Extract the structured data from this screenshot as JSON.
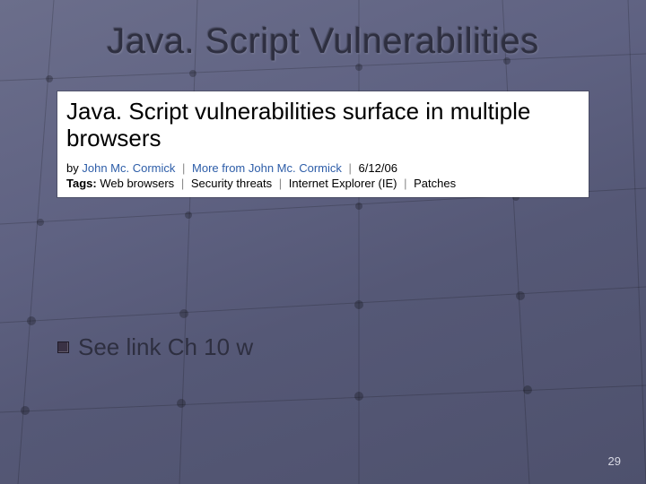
{
  "title": "Java. Script Vulnerabilities",
  "article": {
    "headline": "Java. Script vulnerabilities surface in multiple browsers",
    "by_label": "by",
    "author": "John Mc. Cormick",
    "more_from": "More from John Mc. Cormick",
    "date": "6/12/06",
    "tags_label": "Tags:",
    "tags": {
      "t1": "Web browsers",
      "t2": "Security threats",
      "t3": "Internet Explorer (IE)",
      "t4": "Patches"
    },
    "sep": "|"
  },
  "bullet_text": "See link Ch 10 w",
  "page_number": "29"
}
